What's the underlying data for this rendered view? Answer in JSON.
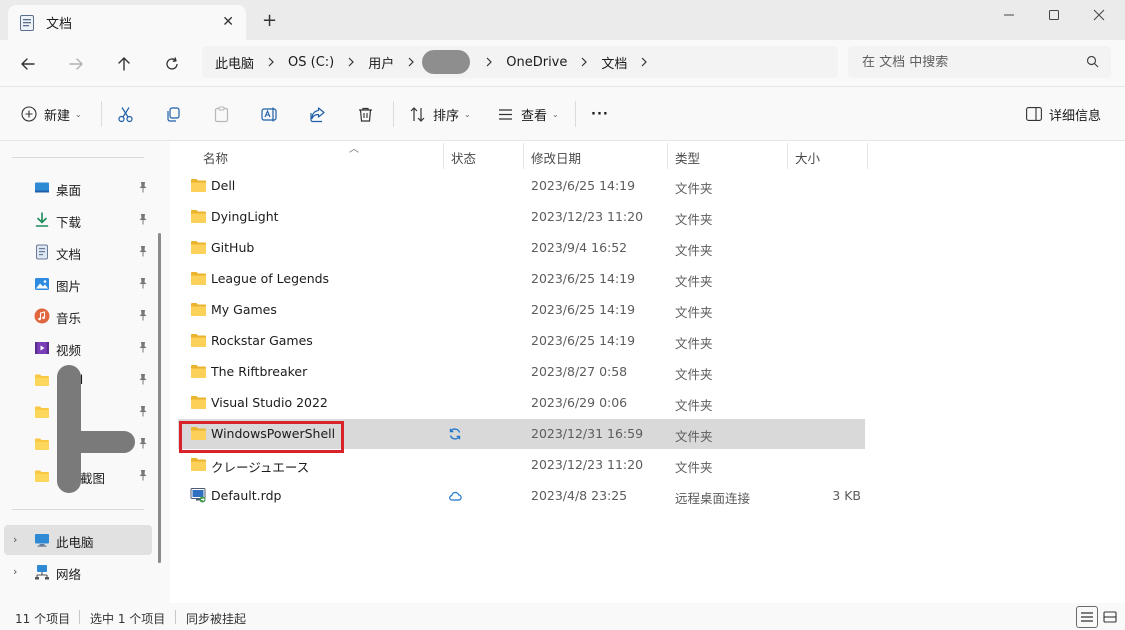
{
  "window": {
    "tab_title": "文档",
    "tab_icon": "document-icon",
    "new_tab_label": "+",
    "minimize_label": "—",
    "maximize_label": "☐",
    "close_label": "✕"
  },
  "address": {
    "breadcrumbs": [
      "此电脑",
      "OS (C:)",
      "用户",
      "OneDrive",
      "文档"
    ],
    "search_placeholder": "在 文档 中搜索"
  },
  "toolbar": {
    "new_label": "新建",
    "sort_label": "排序",
    "view_label": "查看",
    "more_label": "···",
    "details_label": "详细信息"
  },
  "nav": {
    "quick_access": [
      {
        "label": "桌面",
        "icon": "desktop-icon",
        "pinned": true
      },
      {
        "label": "下载",
        "icon": "download-icon",
        "pinned": true
      },
      {
        "label": "文档",
        "icon": "document-icon",
        "pinned": true
      },
      {
        "label": "图片",
        "icon": "pictures-icon",
        "pinned": true
      },
      {
        "label": "音乐",
        "icon": "music-icon",
        "pinned": true
      },
      {
        "label": "视频",
        "icon": "video-icon",
        "pinned": true
      },
      {
        "label": "el",
        "icon": "folder-icon",
        "pinned": true
      },
      {
        "label": "",
        "icon": "folder-icon",
        "pinned": true
      },
      {
        "label": "",
        "icon": "folder-icon",
        "pinned": true
      },
      {
        "label": "截图",
        "icon": "folder-icon",
        "pinned": true
      }
    ],
    "this_pc_label": "此电脑",
    "network_label": "网络"
  },
  "columns": {
    "name": "名称",
    "status": "状态",
    "modified": "修改日期",
    "type": "类型",
    "size": "大小"
  },
  "files": [
    {
      "name": "Dell",
      "date": "2023/6/25 14:19",
      "type": "文件夹",
      "size": "",
      "status": "",
      "icon": "folder-icon"
    },
    {
      "name": "DyingLight",
      "date": "2023/12/23 11:20",
      "type": "文件夹",
      "size": "",
      "status": "",
      "icon": "folder-icon"
    },
    {
      "name": "GitHub",
      "date": "2023/9/4 16:52",
      "type": "文件夹",
      "size": "",
      "status": "",
      "icon": "folder-icon"
    },
    {
      "name": "League of Legends",
      "date": "2023/6/25 14:19",
      "type": "文件夹",
      "size": "",
      "status": "",
      "icon": "folder-icon"
    },
    {
      "name": "My Games",
      "date": "2023/6/25 14:19",
      "type": "文件夹",
      "size": "",
      "status": "",
      "icon": "folder-icon"
    },
    {
      "name": "Rockstar Games",
      "date": "2023/6/25 14:19",
      "type": "文件夹",
      "size": "",
      "status": "",
      "icon": "folder-icon"
    },
    {
      "name": "The Riftbreaker",
      "date": "2023/8/27 0:58",
      "type": "文件夹",
      "size": "",
      "status": "",
      "icon": "folder-icon"
    },
    {
      "name": "Visual Studio 2022",
      "date": "2023/6/29 0:06",
      "type": "文件夹",
      "size": "",
      "status": "",
      "icon": "folder-icon"
    },
    {
      "name": "WindowsPowerShell",
      "date": "2023/12/31 16:59",
      "type": "文件夹",
      "size": "",
      "status": "sync-pending-icon",
      "icon": "folder-icon",
      "selected": true
    },
    {
      "name": "クレージュエース",
      "date": "2023/12/23 11:20",
      "type": "文件夹",
      "size": "",
      "status": "",
      "icon": "folder-icon"
    },
    {
      "name": "Default.rdp",
      "date": "2023/4/8 23:25",
      "type": "远程桌面连接",
      "size": "3 KB",
      "status": "cloud-icon",
      "icon": "rdp-file-icon"
    }
  ],
  "status_bar": {
    "item_count": "11 个项目",
    "selected": "选中 1 个项目",
    "sync": "同步被挂起"
  },
  "colors": {
    "accent": "#0067c0",
    "folder": "#f8c845",
    "highlight": "#d8232a",
    "selected_row": "#d9d9d9"
  }
}
